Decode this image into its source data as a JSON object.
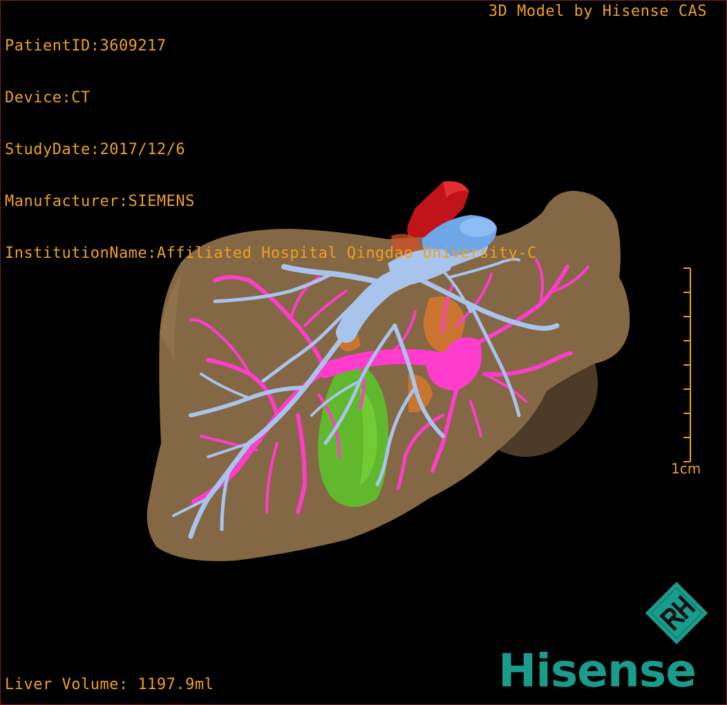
{
  "header": {
    "patient_id": "PatientID:3609217",
    "device": "Device:CT",
    "study_date": "StudyDate:2017/12/6",
    "manufacturer": "Manufacturer:SIEMENS",
    "institution": "InstitutionName:Affiliated Hospital Qingdao University-C"
  },
  "credit": "3D Model by Hisense CAS",
  "footer": {
    "liver_volume": "Liver Volume: 1197.9ml"
  },
  "scale": {
    "label": "1cm"
  },
  "logo": {
    "mark_text": "RH",
    "brand": "Hisense"
  },
  "colors": {
    "overlay_text": "#f0a01e",
    "liver": "#8b6d48",
    "portal_vein": "#ff3ccc",
    "hepatic_vein": "#a8c4ec",
    "vena_cava": "#6fa6e8",
    "aorta": "#c0141a",
    "gallbladder": "#5cc22a",
    "brand": "#1a9c8c"
  }
}
